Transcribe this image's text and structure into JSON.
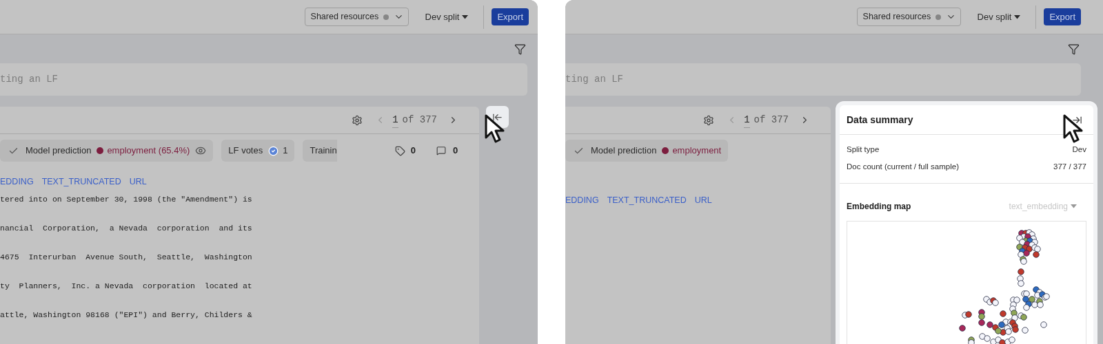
{
  "panels": [
    {
      "header": {
        "resource_select": "Shared resources",
        "split_menu": "Dev split",
        "export_button": "Export"
      },
      "search": {
        "placeholder": "ting an LF"
      },
      "document": {
        "pager": {
          "current": "1",
          "of_total": "of 377"
        },
        "chips": [
          {
            "kind": "prediction",
            "label": "Model prediction",
            "value": "employment (65.4%)",
            "color": "#7c1d3e",
            "eye_icon": true
          },
          {
            "kind": "votes",
            "label": "LF votes",
            "count": "1"
          },
          {
            "kind": "plain",
            "label": "Trainin"
          }
        ],
        "counts": {
          "tags": "0",
          "comments": "0"
        },
        "tags": [
          "EDDING",
          "TEXT_TRUNCATED",
          "URL"
        ],
        "lines": [
          "tered into on September 30, 1998 (the \"Amendment\") is",
          "nancial  Corporation,  a Nevada  corporation  and its",
          "4675  Interurban  Avenue South,  Seattle,  Washington",
          "ty  Planners,  Inc. a Nevada  corporation  located at",
          "attle, Washington 98168 (\"EPI\") and Berry, Childers &"
        ]
      },
      "side_panel": {
        "open": false
      }
    },
    {
      "header": {
        "resource_select": "Shared resources",
        "split_menu": "Dev split",
        "export_button": "Export"
      },
      "search": {
        "placeholder": "ting an LF"
      },
      "document": {
        "pager": {
          "current": "1",
          "of_total": "of 377"
        },
        "chips": [
          {
            "kind": "prediction",
            "label": "Model prediction",
            "value": "employment",
            "color": "#7c1d3e",
            "eye_icon": false
          }
        ],
        "tags": [
          "EDDING",
          "TEXT_TRUNCATED",
          "URL"
        ]
      },
      "side_panel": {
        "open": true,
        "title": "Data summary",
        "rows": [
          {
            "label": "Split type",
            "value": "Dev"
          },
          {
            "label": "Doc count (current / full sample)",
            "value": "377 / 377"
          }
        ],
        "embedding": {
          "label": "Embedding map",
          "selector": "text_embedding"
        }
      }
    }
  ]
}
